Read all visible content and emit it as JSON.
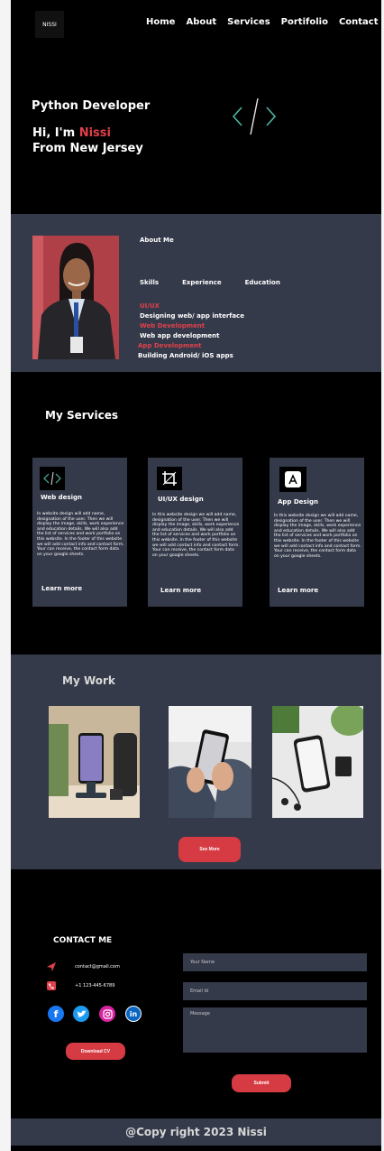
{
  "nav": {
    "logo": "NISSI",
    "links": [
      "Home",
      "About",
      "Services",
      "Portifolio",
      "Contact"
    ]
  },
  "hero": {
    "role": "Python Developer",
    "greeting": "Hi, I'm ",
    "name": "Nissi",
    "location": "From New Jersey"
  },
  "about": {
    "title": "About Me",
    "tabs": [
      "Skills",
      "Experience",
      "Education"
    ],
    "skills": [
      {
        "title": "UI/UX",
        "desc": "Designing web/ app interface"
      },
      {
        "title": "Web Development",
        "desc": "Web app development"
      },
      {
        "title": "App Development",
        "desc": "Building Android/ iOS apps"
      }
    ]
  },
  "services": {
    "title": "My Services",
    "learn_more": "Learn more",
    "cards": [
      {
        "name": "Web design",
        "icon": "code-icon",
        "desc": "In website design will add name, designation of the user. Then we will display the image, skills, work experience and education details. We will also add the list of services and work portfolio on this website. In the footer of this website we will add contact info and contact form. Your can receive, the contact form data on your google sheets."
      },
      {
        "name": "UI/UX design",
        "icon": "crop-icon",
        "desc": "In this website design we will add name, designation of the user. Then we will display the image, skills, work experience and education details. We will also add the list of services and work portfolio on this website. In the footer of this website we will add contact info and contact form. Your can receive, the contact form data on your google sheets."
      },
      {
        "name": "App Design",
        "icon": "app-store-icon",
        "desc": "In this website design we will add name, designation of the user. Then we will display the image, skills, work experience and education details. We will also add the list of services and work portfolio on this website. In the footer of this website we will add contact info and contact form. Your can receive, the contact form data on your google sheets."
      }
    ]
  },
  "work": {
    "title": "My Work",
    "see_more": "See More"
  },
  "contact": {
    "title": "CONTACT ME",
    "email": "contact@gmail.com",
    "phone": "+1 123-445-6789",
    "download_cv": "Download CV",
    "name_placeholder": "Your Name",
    "email_placeholder": "Email Id",
    "message_placeholder": "Message",
    "submit": "Submit",
    "socials": [
      "facebook-icon",
      "twitter-icon",
      "instagram-icon",
      "linkedin-icon"
    ]
  },
  "footer": {
    "copyright": "@Copy right 2023 Nissi"
  },
  "colors": {
    "accent": "#e0404a",
    "panel": "#353a4a",
    "background": "#000000"
  }
}
